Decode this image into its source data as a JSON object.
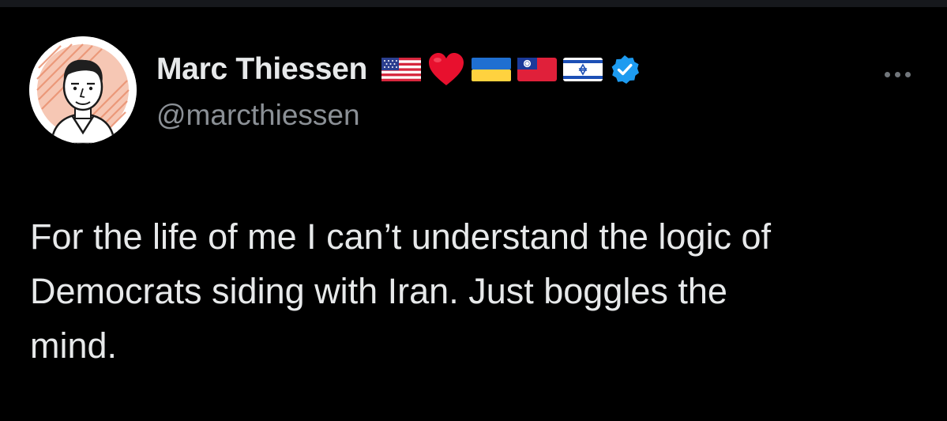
{
  "author": {
    "display_name": "Marc Thiessen",
    "handle": "@marcthiessen",
    "name_emojis": [
      "us-flag",
      "red-heart",
      "ukraine-flag",
      "taiwan-flag",
      "israel-flag"
    ],
    "verified": true,
    "verified_color": "#1d9bf0"
  },
  "tweet": {
    "text": "For the life of me I can’t understand the logic of\nDemocrats siding with Iran. Just boggles the\nmind."
  },
  "colors": {
    "background": "#000000",
    "text_primary": "#e7e9ea",
    "text_secondary": "#8b9096",
    "heart": "#e8102e"
  }
}
